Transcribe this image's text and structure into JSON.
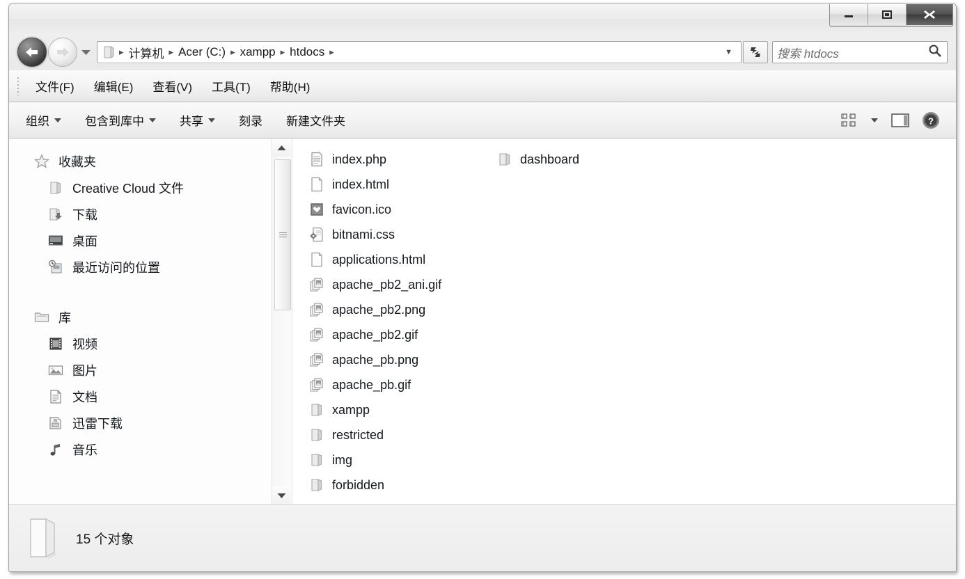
{
  "window": {
    "controls": [
      {
        "name": "minimize",
        "label": "最小化"
      },
      {
        "name": "maximize",
        "label": "最大化"
      },
      {
        "name": "close",
        "label": "关闭"
      }
    ]
  },
  "addressbar": {
    "back_label": "后退",
    "forward_label": "前进",
    "history_label": "最近浏览的位置",
    "refresh_label": "刷新",
    "crumbs": [
      "计算机",
      "Acer (C:)",
      "xampp",
      "htdocs"
    ],
    "separator": "▸",
    "trailing_separator": "▸",
    "dropdown": "▼"
  },
  "search": {
    "placeholder": "搜索 htdocs",
    "icon": "search-icon"
  },
  "menu": {
    "items": [
      {
        "label": "文件(F)"
      },
      {
        "label": "编辑(E)"
      },
      {
        "label": "查看(V)"
      },
      {
        "label": "工具(T)"
      },
      {
        "label": "帮助(H)"
      }
    ]
  },
  "toolbar": {
    "items": [
      {
        "label": "组织",
        "caret": true,
        "name": "organize"
      },
      {
        "label": "包含到库中",
        "caret": true,
        "name": "include-in-library"
      },
      {
        "label": "共享",
        "caret": true,
        "name": "share-with"
      },
      {
        "label": "刻录",
        "caret": false,
        "name": "burn"
      },
      {
        "label": "新建文件夹",
        "caret": false,
        "name": "new-folder"
      }
    ],
    "right_icons": [
      {
        "name": "change-view-icon",
        "label": "更改您的视图"
      },
      {
        "name": "view-dropdown-caret",
        "label": "视图选项"
      },
      {
        "name": "preview-pane-icon",
        "label": "显示预览窗格"
      },
      {
        "name": "help-icon",
        "label": "获取帮助"
      }
    ]
  },
  "navpane": {
    "groups": [
      {
        "header": {
          "label": "收藏夹",
          "icon": "star-icon"
        },
        "items": [
          {
            "label": "Creative Cloud 文件",
            "icon": "folder-icon"
          },
          {
            "label": "下载",
            "icon": "downloads-folder-icon"
          },
          {
            "label": "桌面",
            "icon": "desktop-icon"
          },
          {
            "label": "最近访问的位置",
            "icon": "recent-places-icon"
          }
        ]
      },
      {
        "header": {
          "label": "库",
          "icon": "library-icon"
        },
        "items": [
          {
            "label": "视频",
            "icon": "video-library-icon"
          },
          {
            "label": "图片",
            "icon": "pictures-library-icon"
          },
          {
            "label": "文档",
            "icon": "documents-library-icon"
          },
          {
            "label": "迅雷下载",
            "icon": "thunder-download-icon"
          },
          {
            "label": "音乐",
            "icon": "music-library-icon"
          }
        ]
      }
    ],
    "scrollbar": {
      "up": "▲",
      "down": "▼"
    }
  },
  "files": {
    "items": [
      {
        "name": "index.php",
        "icon": "php-file-icon",
        "type": "file"
      },
      {
        "name": "index.html",
        "icon": "html-file-icon",
        "type": "file"
      },
      {
        "name": "favicon.ico",
        "icon": "ico-file-icon",
        "type": "file"
      },
      {
        "name": "bitnami.css",
        "icon": "css-file-icon",
        "type": "file"
      },
      {
        "name": "applications.html",
        "icon": "html-file-icon",
        "type": "file"
      },
      {
        "name": "apache_pb2_ani.gif",
        "icon": "image-file-icon",
        "type": "file"
      },
      {
        "name": "apache_pb2.png",
        "icon": "image-file-icon",
        "type": "file"
      },
      {
        "name": "apache_pb2.gif",
        "icon": "image-file-icon",
        "type": "file"
      },
      {
        "name": "apache_pb.png",
        "icon": "image-file-icon",
        "type": "file"
      },
      {
        "name": "apache_pb.gif",
        "icon": "image-file-icon",
        "type": "file"
      },
      {
        "name": "xampp",
        "icon": "folder-icon",
        "type": "folder"
      },
      {
        "name": "restricted",
        "icon": "folder-icon",
        "type": "folder"
      },
      {
        "name": "img",
        "icon": "folder-icon",
        "type": "folder"
      },
      {
        "name": "forbidden",
        "icon": "folder-icon",
        "type": "folder"
      },
      {
        "name": "dashboard",
        "icon": "folder-icon",
        "type": "folder"
      }
    ]
  },
  "statusbar": {
    "icon": "large-folder-icon",
    "text": "15 个对象"
  },
  "colors": {
    "window_chrome": "#f0f0f0",
    "pane_background": "#ffffff",
    "text": "#15191e",
    "border": "#a0a0a0",
    "close_button": "#3d3d3d"
  }
}
